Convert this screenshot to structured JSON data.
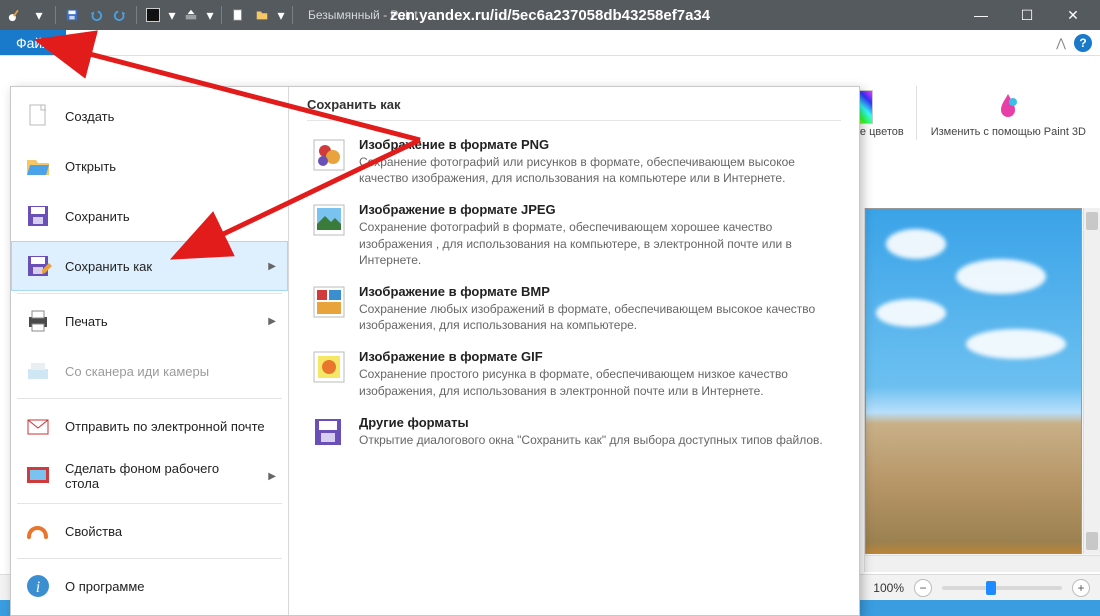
{
  "titlebar": {
    "doc_title": "Безымянный - Paint",
    "overlay_url": "zen.yandex.ru/id/5ec6a237058db43258ef7a34"
  },
  "ribbon": {
    "file_tab": "Файл",
    "edit_colors": "Изменение цветов",
    "paint3d": "Изменить с помощью Paint 3D"
  },
  "menu": {
    "new": "Создать",
    "open": "Открыть",
    "save": "Сохранить",
    "save_as": "Сохранить как",
    "print": "Печать",
    "scanner": "Со сканера иди камеры",
    "email": "Отправить по электронной почте",
    "wallpaper": "Сделать фоном рабочего стола",
    "properties": "Свойства",
    "about": "О программе"
  },
  "submenu": {
    "header": "Сохранить как",
    "items": [
      {
        "title": "Изображение в формате PNG",
        "desc": "Сохранение фотографий или рисунков в формате, обеспечивающем высокое качество изображения, для использования на компьютере или в Интернете."
      },
      {
        "title": "Изображение в формате JPEG",
        "desc": "Сохранение фотографий в формате, обеспечивающем хорошее качество изображения , для использования на компьютере, в электронной почте или в Интернете."
      },
      {
        "title": "Изображение в формате BMP",
        "desc": "Сохранение любых изображений в формате, обеспечивающем высокое качество изображения, для использования на компьютере."
      },
      {
        "title": "Изображение в формате GIF",
        "desc": "Сохранение простого рисунка в формате, обеспечивающем низкое качество изображения, для использования в электронной почте или в Интернете."
      },
      {
        "title": "Другие форматы",
        "desc": "Открытие диалогового окна \"Сохранить как\" для выбора доступных типов файлов."
      }
    ]
  },
  "statusbar": {
    "zoom_pct": "100%"
  },
  "colors": {
    "swatch1": "#a86cb8",
    "swatch2": "#ffffff"
  }
}
